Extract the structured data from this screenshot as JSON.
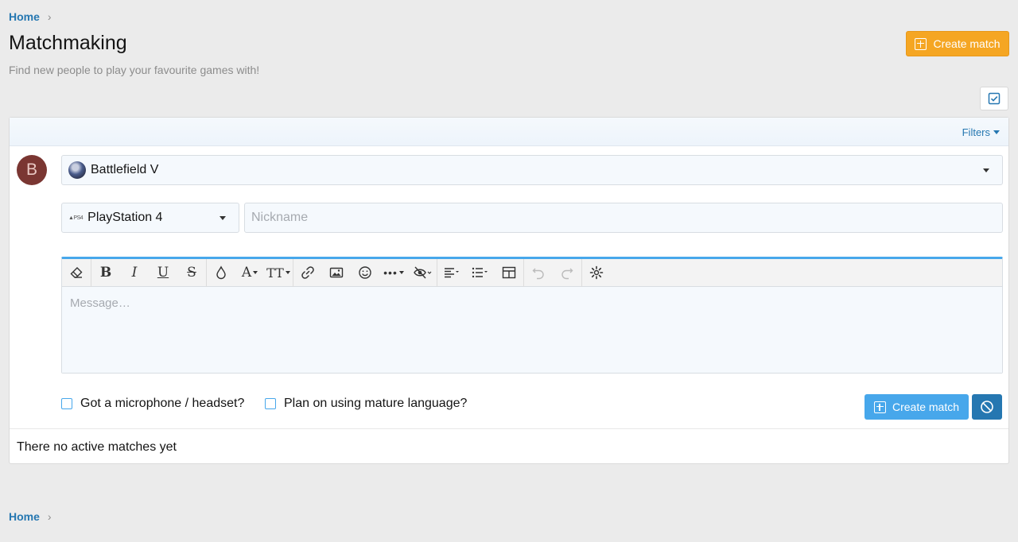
{
  "breadcrumb": {
    "home": "Home"
  },
  "header": {
    "title": "Matchmaking",
    "description": "Find new people to play your favourite games with!",
    "create_button": "Create match"
  },
  "filters": {
    "label": "Filters"
  },
  "user": {
    "avatar_letter": "B",
    "avatar_color": "#7a3632"
  },
  "form": {
    "game": {
      "selected": "Battlefield V"
    },
    "platform": {
      "selected": "PlayStation 4",
      "icon_text": "▲PS4"
    },
    "nickname": {
      "placeholder": "Nickname",
      "value": ""
    },
    "message": {
      "placeholder": "Message…"
    },
    "checkboxes": {
      "microphone": "Got a microphone / headset?",
      "mature": "Plan on using mature language?"
    },
    "submit_button": "Create match"
  },
  "toolbar": {
    "icons": [
      "eraser-icon",
      "bold-icon",
      "italic-icon",
      "underline-icon",
      "strikethrough-icon",
      "color-drop-icon",
      "font-family-icon",
      "font-size-icon",
      "link-icon",
      "image-icon",
      "smiley-icon",
      "more-icon",
      "hide-icon",
      "align-icon",
      "list-icon",
      "table-icon",
      "undo-icon",
      "redo-icon",
      "settings-icon"
    ]
  },
  "matches": {
    "empty_text": "There no active matches yet"
  },
  "colors": {
    "accent": "#47a7eb",
    "link": "#2577b1",
    "orange": "#f5a623"
  }
}
